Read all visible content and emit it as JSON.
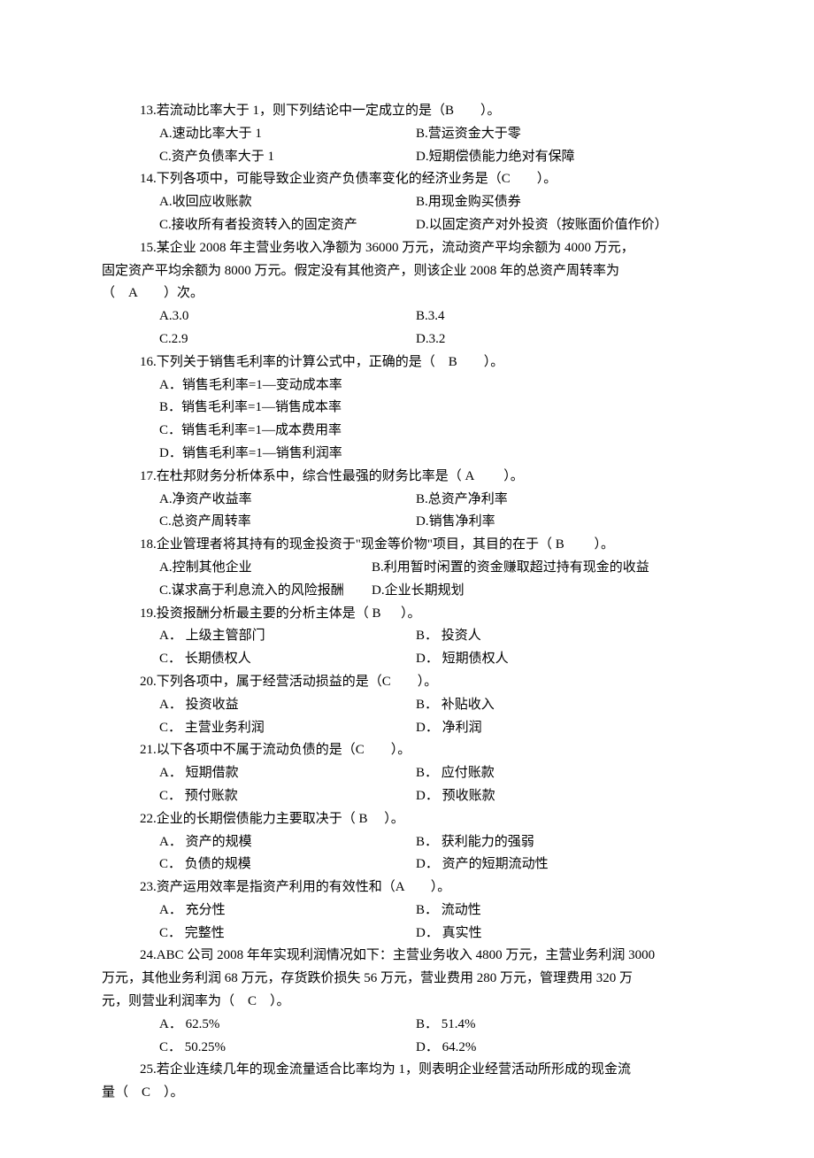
{
  "q13": {
    "stem": "13.若流动比率大于 1，则下列结论中一定成立的是（B　　）。",
    "a": "A.速动比率大于 1",
    "b": "B.营运资金大于零",
    "c": "C.资产负债率大于 1",
    "d": "D.短期偿债能力绝对有保障"
  },
  "q14": {
    "stem": "14.下列各项中，可能导致企业资产负债率变化的经济业务是（C　　）。",
    "a": "A.收回应收账款",
    "b": "B.用现金购买债券",
    "c": "C.接收所有者投资转入的固定资产",
    "d": "D.以固定资产对外投资（按账面价值作价）"
  },
  "q15": {
    "stem": "15.某企业 2008 年主营业务收入净额为 36000 万元，流动资产平均余额为 4000 万元，",
    "cont": "固定资产平均余额为 8000 万元。假定没有其他资产，则该企业 2008 年的总资产周转率为\n（　A　　）次。",
    "a": "A.3.0",
    "b": "B.3.4",
    "c": "C.2.9",
    "d": "D.3.2"
  },
  "q16": {
    "stem": "16.下列关于销售毛利率的计算公式中，正确的是（　B　　）。",
    "a": "A．销售毛利率=1—变动成本率",
    "b": "B．销售毛利率=1—销售成本率",
    "c": "C．销售毛利率=1—成本费用率",
    "d": "D．销售毛利率=1—销售利润率"
  },
  "q17": {
    "stem": "17.在杜邦财务分析体系中，综合性最强的财务比率是（ A　　 ）。",
    "a": "A.净资产收益率",
    "b": "B.总资产净利率",
    "c": "C.总资产周转率",
    "d": "D.销售净利率"
  },
  "q18": {
    "stem": "18.企业管理者将其持有的现金投资于\"现金等价物\"项目，其目的在于（ B 　　）。",
    "a": "A.控制其他企业",
    "b": "B.利用暂时闲置的资金赚取超过持有现金的收益",
    "c": "C.谋求高于利息流入的风险报酬",
    "d": "D.企业长期规划"
  },
  "q19": {
    "stem": "19.投资报酬分析最主要的分析主体是（ B 　 ）。",
    "a": "A． 上级主管部门",
    "b": "B． 投资人",
    "c": "C． 长期债权人",
    "d": "D． 短期债权人"
  },
  "q20": {
    "stem": "20.下列各项中，属于经营活动损益的是（C　　）。",
    "a": "A． 投资收益",
    "b": "B． 补贴收入",
    "c": "C． 主营业务利润",
    "d": "D． 净利润"
  },
  "q21": {
    "stem": "21.以下各项中不属于流动负债的是（C　　）。",
    "a": "A． 短期借款",
    "b": "B． 应付账款",
    "c": "C． 预付账款",
    "d": "D． 预收账款"
  },
  "q22": {
    "stem": "22.企业的长期偿债能力主要取决于（ B 　）。",
    "a": "A． 资产的规模",
    "b": "B． 获利能力的强弱",
    "c": "C． 负债的规模",
    "d": "D． 资产的短期流动性"
  },
  "q23": {
    "stem": "23.资产运用效率是指资产利用的有效性和（A　　）。",
    "a": "A． 充分性",
    "b": "B． 流动性",
    "c": "C． 完整性",
    "d": "D． 真实性"
  },
  "q24": {
    "stem": "24.ABC 公司 2008 年年实现利润情况如下：主营业务收入 4800 万元，主营业务利润 3000",
    "cont": "万元，其他业务利润 68 万元，存货跌价损失 56 万元，营业费用 280 万元，管理费用 320 万\n元，则营业利润率为（　C　）。",
    "a": "A． 62.5%",
    "b": "B． 51.4%",
    "c": "C． 50.25%",
    "d": "D． 64.2%"
  },
  "q25": {
    "stem": "25.若企业连续几年的现金流量适合比率均为 1，则表明企业经营活动所形成的现金流",
    "cont": "量（　C　）。"
  }
}
